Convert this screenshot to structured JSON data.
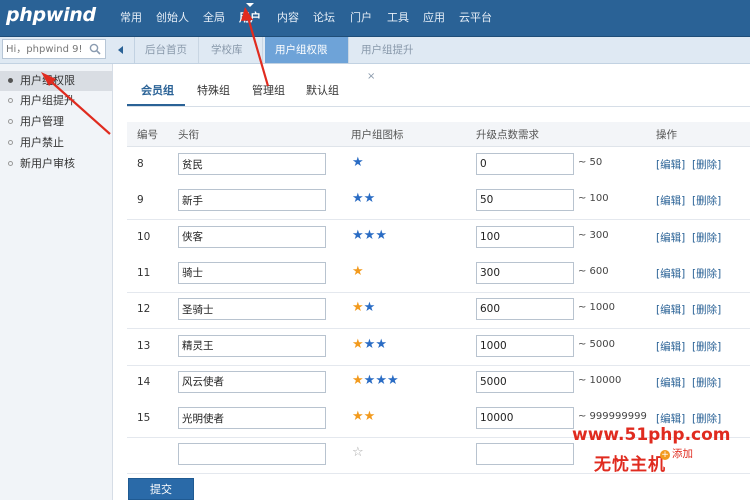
{
  "app": {
    "logo": "phpwind"
  },
  "nav": {
    "items": [
      {
        "label": "常用"
      },
      {
        "label": "创始人"
      },
      {
        "label": "全局"
      },
      {
        "label": "用户"
      },
      {
        "label": "内容"
      },
      {
        "label": "论坛"
      },
      {
        "label": "门户"
      },
      {
        "label": "工具"
      },
      {
        "label": "应用"
      },
      {
        "label": "云平台"
      }
    ],
    "active_index": 3
  },
  "search": {
    "placeholder": "Hi，phpwind 9!"
  },
  "tabs": [
    {
      "label": "后台首页"
    },
    {
      "label": "学校库"
    },
    {
      "label": "用户组权限",
      "close": "×"
    },
    {
      "label": "用户组提升",
      "close": "×"
    }
  ],
  "sidebar": {
    "items": [
      {
        "label": "用户组权限"
      },
      {
        "label": "用户组提升"
      },
      {
        "label": "用户管理"
      },
      {
        "label": "用户禁止"
      },
      {
        "label": "新用户审核"
      }
    ]
  },
  "group_tabs": [
    {
      "label": "会员组"
    },
    {
      "label": "特殊组"
    },
    {
      "label": "管理组"
    },
    {
      "label": "默认组"
    }
  ],
  "table": {
    "headers": {
      "id": "编号",
      "title": "头衔",
      "icon": "用户组图标",
      "points": "升级点数需求",
      "actions": "操作"
    },
    "edit_label": "[编辑]",
    "delete_label": "[删除]",
    "rows": [
      {
        "id": "8",
        "title": "贫民",
        "stars": "b1",
        "min": "0",
        "max": "~ 50"
      },
      {
        "id": "9",
        "title": "新手",
        "stars": "b2",
        "min": "50",
        "max": "~ 100"
      },
      {
        "id": "10",
        "title": "侠客",
        "stars": "b3",
        "min": "100",
        "max": "~ 300"
      },
      {
        "id": "11",
        "title": "骑士",
        "stars": "o1",
        "min": "300",
        "max": "~ 600"
      },
      {
        "id": "12",
        "title": "圣骑士",
        "stars": "o1b1",
        "min": "600",
        "max": "~ 1000"
      },
      {
        "id": "13",
        "title": "精灵王",
        "stars": "o1b2",
        "min": "1000",
        "max": "~ 5000"
      },
      {
        "id": "14",
        "title": "风云使者",
        "stars": "o1b3",
        "min": "5000",
        "max": "~ 10000"
      },
      {
        "id": "15",
        "title": "光明使者",
        "stars": "o2",
        "min": "10000",
        "max": "~ 999999999"
      }
    ],
    "new_row": {
      "title": "",
      "min": ""
    }
  },
  "submit_label": "提交",
  "watermark": {
    "url": "www.51php.com",
    "name": "无忧主机"
  },
  "add_label": "添加",
  "colors": {
    "brand": "#2a6296",
    "star_blue": "#2a6cc4",
    "star_orange": "#f29a1d",
    "annotation": "#e02b1f"
  },
  "icons": [
    "search-icon",
    "collapse-icon",
    "close-icon",
    "star-icon",
    "add-icon",
    "arrow-annotation"
  ]
}
